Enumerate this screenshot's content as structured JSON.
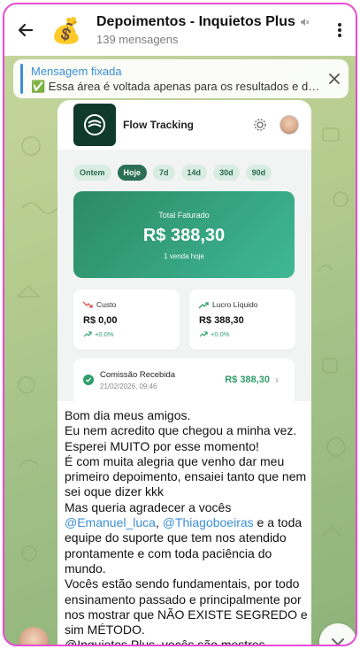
{
  "header": {
    "title": "Depoimentos - Inquietos Plus",
    "subtitle": "139 mensagens",
    "avatar_emoji": "💰",
    "muted_icon": "muted-speaker-icon"
  },
  "pinned": {
    "label": "Mensagem fixada",
    "message": "✅ Essa área é voltada apenas para os resultados e de..."
  },
  "screenshot": {
    "app_name": "Flow Tracking",
    "chips": [
      "Ontem",
      "Hoje",
      "7d",
      "14d",
      "30d",
      "90d"
    ],
    "active_chip": "Hoje",
    "hero": {
      "label": "Total Faturado",
      "value": "R$ 388,30",
      "sub": "1 venda hoje"
    },
    "cards": {
      "cost": {
        "label": "Custo",
        "value": "R$ 0,00",
        "delta": "+0.0%"
      },
      "profit": {
        "label": "Lucro Líquido",
        "value": "R$ 388,30",
        "delta": "+0.0%"
      }
    },
    "commission": {
      "title": "Comissão Recebida",
      "date": "21/02/2026, 09:46",
      "value": "R$ 388,30"
    }
  },
  "message": {
    "part1": "Bom dia meus amigos.\nEu nem acredito que chegou a minha vez.\nEsperei MUITO por esse momento!\nÉ com muita alegria que venho dar meu primeiro depoimento, ensaiei tanto que nem sei oque dizer kkk\nMas queria agradecer a vocês ",
    "mention1": "@Emanuel_luca",
    "part2": ", ",
    "mention2": "@Thiagoboeiras",
    "part3": " e a toda equipe do suporte que tem nos atendido prontamente e com toda paciência do mundo.\nVocês estão sendo fundamentais, por todo ensinamento passado e principalmente por nos mostrar que NÃO EXISTE SEGREDO e sim MÉTODO.\n@Inquietos Plus, vocês são mestres"
  },
  "colors": {
    "accent_blue": "#3a8fd8",
    "brand_green": "#2b6f55",
    "positive_green": "#2f9e6b",
    "frame_pink": "#e84bd6"
  }
}
